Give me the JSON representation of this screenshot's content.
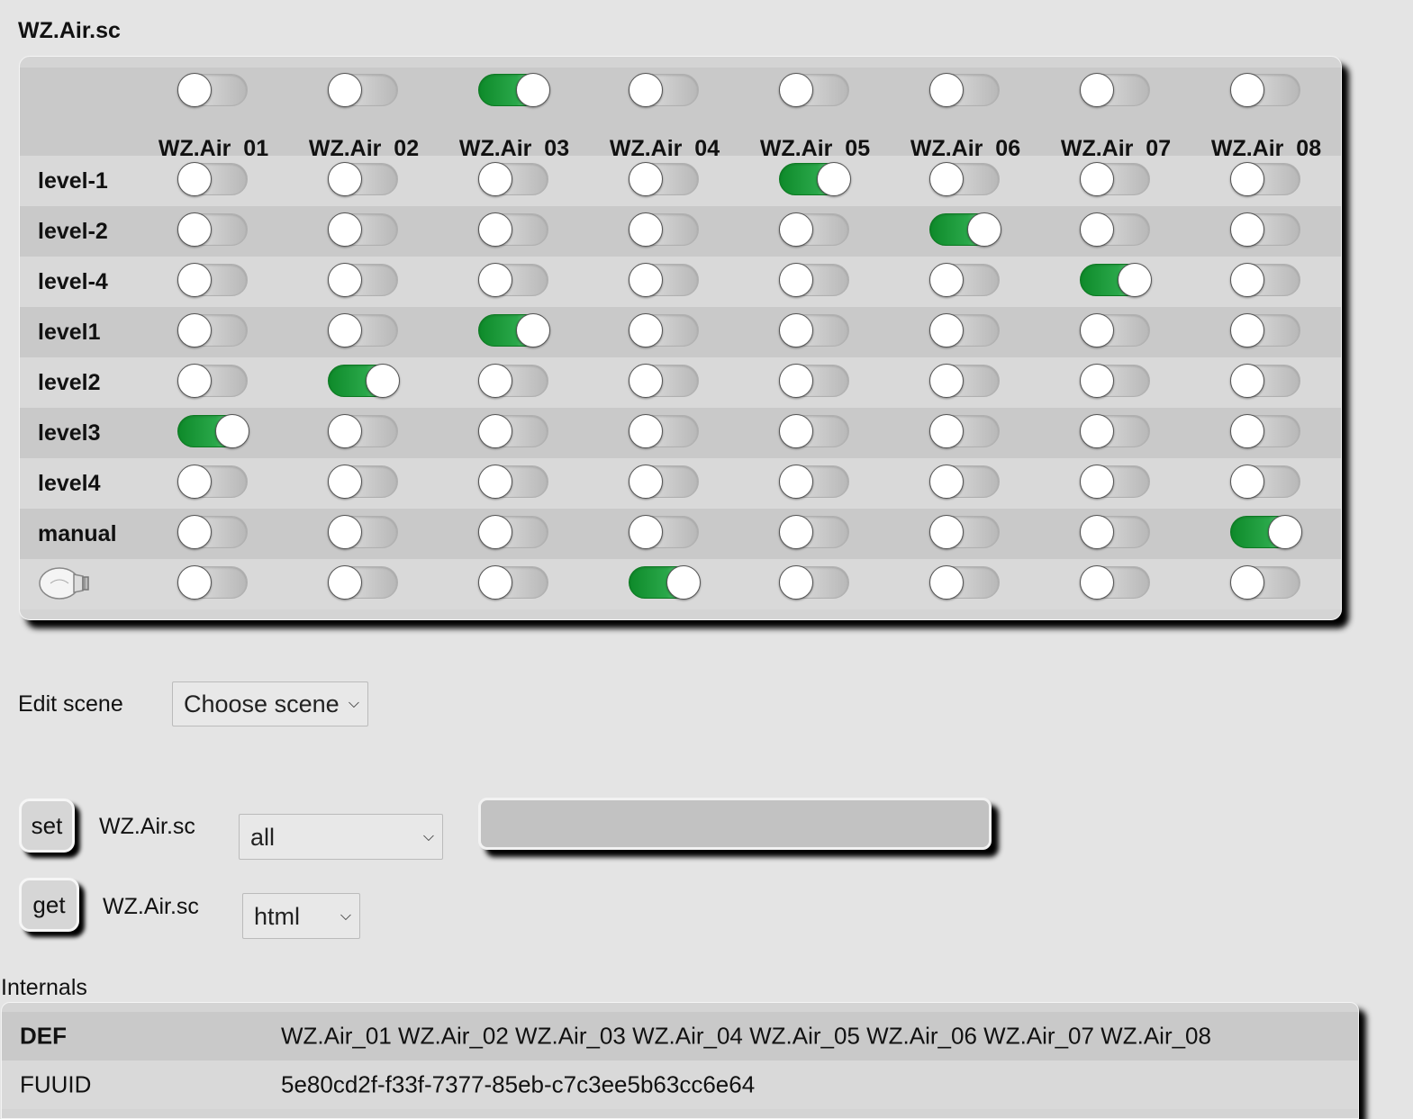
{
  "page": {
    "title": "WZ.Air.sc"
  },
  "scene_table": {
    "devices": [
      "WZ.Air_01",
      "WZ.Air_02",
      "WZ.Air_03",
      "WZ.Air_04",
      "WZ.Air_05",
      "WZ.Air_06",
      "WZ.Air_07",
      "WZ.Air_08"
    ],
    "header_toggles": [
      false,
      false,
      true,
      false,
      false,
      false,
      false,
      false
    ],
    "scenes": [
      {
        "label": "level-1",
        "states": [
          false,
          false,
          false,
          false,
          true,
          false,
          false,
          false
        ]
      },
      {
        "label": "level-2",
        "states": [
          false,
          false,
          false,
          false,
          false,
          true,
          false,
          false
        ]
      },
      {
        "label": "level-4",
        "states": [
          false,
          false,
          false,
          false,
          false,
          false,
          true,
          false
        ]
      },
      {
        "label": "level1",
        "states": [
          false,
          false,
          true,
          false,
          false,
          false,
          false,
          false
        ]
      },
      {
        "label": "level2",
        "states": [
          false,
          true,
          false,
          false,
          false,
          false,
          false,
          false
        ]
      },
      {
        "label": "level3",
        "states": [
          true,
          false,
          false,
          false,
          false,
          false,
          false,
          false
        ]
      },
      {
        "label": "level4",
        "states": [
          false,
          false,
          false,
          false,
          false,
          false,
          false,
          false
        ]
      },
      {
        "label": "manual",
        "states": [
          false,
          false,
          false,
          false,
          false,
          false,
          false,
          true
        ]
      }
    ],
    "bulb_row": {
      "icon": "light-bulb-icon",
      "states": [
        false,
        false,
        false,
        true,
        false,
        false,
        false,
        false
      ]
    },
    "colors": {
      "toggle_on": "#1a9a38",
      "toggle_off": "#c8c8c8"
    }
  },
  "edit_scene": {
    "label": "Edit scene",
    "select_value": "Choose scene"
  },
  "commands": {
    "set": {
      "button": "set",
      "device": "WZ.Air.sc",
      "select_value": "all",
      "input_value": ""
    },
    "get": {
      "button": "get",
      "device": "WZ.Air.sc",
      "select_value": "html"
    }
  },
  "internals": {
    "label": "Internals",
    "rows": [
      {
        "key": "DEF",
        "value": "WZ.Air_01 WZ.Air_02 WZ.Air_03 WZ.Air_04 WZ.Air_05 WZ.Air_06 WZ.Air_07 WZ.Air_08",
        "bold": true
      },
      {
        "key": "FUUID",
        "value": "5e80cd2f-f33f-7377-85eb-c7c3ee5b63cc6e64",
        "bold": false
      }
    ]
  }
}
